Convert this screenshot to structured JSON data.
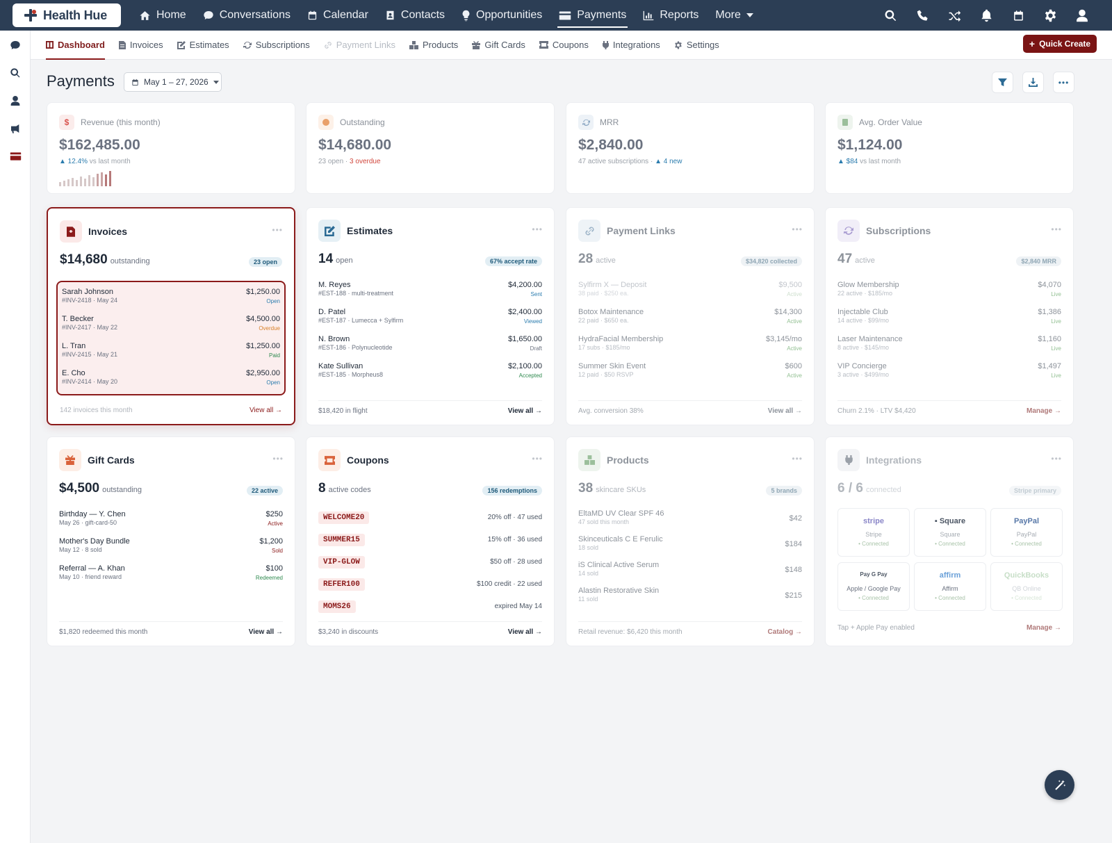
{
  "app": {
    "name": "Health Hue"
  },
  "topnav": {
    "items": [
      {
        "label": "Home",
        "icon": "home-icon"
      },
      {
        "label": "Conversations",
        "icon": "chat-icon"
      },
      {
        "label": "Calendar",
        "icon": "calendar-icon"
      },
      {
        "label": "Contacts",
        "icon": "contacts-icon"
      },
      {
        "label": "Opportunities",
        "icon": "lightbulb-icon"
      },
      {
        "label": "Payments",
        "icon": "card-icon",
        "active": true
      },
      {
        "label": "Reports",
        "icon": "chart-icon"
      },
      {
        "label": "More",
        "icon": "caret-down-icon"
      }
    ],
    "right_icons": [
      "search-icon",
      "phone-icon",
      "shuffle-icon",
      "bell-icon",
      "calendar-icon",
      "gear-icon",
      "user-icon"
    ]
  },
  "leftbar": {
    "icons": [
      "chat-icon",
      "search-icon",
      "user-icon",
      "megaphone-icon",
      "card-icon"
    ]
  },
  "subnav": {
    "items": [
      {
        "label": "Dashboard",
        "active": true
      },
      {
        "label": "Invoices"
      },
      {
        "label": "Estimates"
      },
      {
        "label": "Subscriptions"
      },
      {
        "label": "Payment Links",
        "dim": true
      },
      {
        "label": "Products"
      },
      {
        "label": "Gift Cards"
      },
      {
        "label": "Coupons"
      },
      {
        "label": "Integrations"
      },
      {
        "label": "Settings"
      }
    ],
    "quick_create": "Quick Create"
  },
  "header": {
    "title": "Payments",
    "date_range": "May 1 – 27, 2026",
    "tools": [
      "filter-icon",
      "download-icon",
      "more-icon"
    ]
  },
  "kpis": [
    {
      "label": "Revenue (this month)",
      "value": "$162,485.00",
      "delta": "▲ 12.4%",
      "sub": " vs last month",
      "icon": "dollar-icon",
      "color": "#d9534f",
      "spark": [
        6,
        8,
        10,
        12,
        9,
        14,
        11,
        16,
        13,
        18,
        20,
        17,
        22
      ]
    },
    {
      "label": "Outstanding",
      "value": "$14,680.00",
      "sub": "23 open · ",
      "alert": "3 overdue",
      "icon": "alert-icon",
      "color": "#e08a4a"
    },
    {
      "label": "MRR",
      "value": "$2,840.00",
      "sub": "47 active subscriptions · ",
      "delta": "▲ 4 new",
      "icon": "refresh-icon",
      "color": "#6b8fb5"
    },
    {
      "label": "Avg. Order Value",
      "value": "$1,124.00",
      "delta": "▲ $84",
      "sub": " vs last month",
      "icon": "receipt-icon",
      "color": "#6b9a6b"
    }
  ],
  "invoices": {
    "title": "Invoices",
    "big": "$14,680",
    "big_sub": "outstanding",
    "badge": "23 open",
    "rows": [
      {
        "name": "Sarah Johnson",
        "sub": "#INV-2418 · May 24",
        "amount": "$1,250.00",
        "status": "Open"
      },
      {
        "name": "T. Becker",
        "sub": "#INV-2417 · May 22",
        "amount": "$4,500.00",
        "status": "Overdue"
      },
      {
        "name": "L. Tran",
        "sub": "#INV-2415 · May 21",
        "amount": "$1,250.00",
        "status": "Paid"
      },
      {
        "name": "E. Cho",
        "sub": "#INV-2414 · May 20",
        "amount": "$2,950.00",
        "status": "Open"
      }
    ],
    "foot": "142 invoices this month",
    "link": "View all →"
  },
  "estimates": {
    "title": "Estimates",
    "big": "14",
    "big_sub": "open",
    "badge": "67% accept rate",
    "rows": [
      {
        "name": "M. Reyes",
        "sub": "#EST-188 · multi-treatment",
        "amount": "$4,200.00",
        "status": "Sent"
      },
      {
        "name": "D. Patel",
        "sub": "#EST-187 · Lumecca + Sylfirm",
        "amount": "$2,400.00",
        "status": "Viewed"
      },
      {
        "name": "N. Brown",
        "sub": "#EST-186 · Polynucleotide",
        "amount": "$1,650.00",
        "status": "Draft"
      },
      {
        "name": "Kate Sullivan",
        "sub": "#EST-185 · Morpheus8",
        "amount": "$2,100.00",
        "status": "Accepted"
      }
    ],
    "foot": "$18,420 in flight",
    "link": "View all →"
  },
  "payment_links": {
    "title": "Payment Links",
    "big": "28",
    "big_sub": "active",
    "badge": "$34,820 collected",
    "rows": [
      {
        "name": "Sylfirm X — Deposit",
        "sub": "38 paid · $250 ea.",
        "amount": "$9,500",
        "status": "Active"
      },
      {
        "name": "Botox Maintenance",
        "sub": "22 paid · $650 ea.",
        "amount": "$14,300",
        "status": "Active"
      },
      {
        "name": "HydraFacial Membership",
        "sub": "17 subs · $185/mo",
        "amount": "$3,145/mo",
        "status": "Active"
      },
      {
        "name": "Summer Skin Event",
        "sub": "12 paid · $50 RSVP",
        "amount": "$600",
        "status": "Active"
      }
    ],
    "foot": "Avg. conversion 38%",
    "link": "View all →"
  },
  "subscriptions": {
    "title": "Subscriptions",
    "big": "47",
    "big_sub": "active",
    "badge": "$2,840 MRR",
    "rows": [
      {
        "name": "Glow Membership",
        "sub": "22 active · $185/mo",
        "amount": "$4,070",
        "status": "Live"
      },
      {
        "name": "Injectable Club",
        "sub": "14 active · $99/mo",
        "amount": "$1,386",
        "status": "Live"
      },
      {
        "name": "Laser Maintenance",
        "sub": "8 active · $145/mo",
        "amount": "$1,160",
        "status": "Live"
      },
      {
        "name": "VIP Concierge",
        "sub": "3 active · $499/mo",
        "amount": "$1,497",
        "status": "Live"
      }
    ],
    "foot": "Churn 2.1% · LTV $4,420",
    "link": "Manage →"
  },
  "gift_cards": {
    "title": "Gift Cards",
    "big": "$4,500",
    "big_sub": "outstanding",
    "badge": "22 active",
    "rows": [
      {
        "name": "Birthday — Y. Chen",
        "sub": "May 26 · gift-card-50",
        "amount": "$250",
        "status": "Active"
      },
      {
        "name": "Mother's Day Bundle",
        "sub": "May 12 · 8 sold",
        "amount": "$1,200",
        "status": "Sold"
      },
      {
        "name": "Referral — A. Khan",
        "sub": "May 10 · friend reward",
        "amount": "$100",
        "status": "Redeemed"
      }
    ],
    "foot": "$1,820 redeemed this month",
    "link": "View all →"
  },
  "coupons": {
    "title": "Coupons",
    "big": "8",
    "big_sub": "active codes",
    "badge": "156 redemptions",
    "rows": [
      {
        "code": "WELCOME20",
        "desc": "20% off · 47 used"
      },
      {
        "code": "SUMMER15",
        "desc": "15% off · 36 used"
      },
      {
        "code": "VIP-GLOW",
        "desc": "$50 off · 28 used"
      },
      {
        "code": "REFER100",
        "desc": "$100 credit · 22 used"
      },
      {
        "code": "MOMS26",
        "desc": "expired May 14"
      }
    ],
    "foot": "$3,240 in discounts",
    "link": "View all →"
  },
  "products": {
    "title": "Products",
    "big": "38",
    "big_sub": "skincare SKUs",
    "badge": "5 brands",
    "rows": [
      {
        "name": "EltaMD UV Clear SPF 46",
        "sub": "47 sold this month",
        "amount": "$42"
      },
      {
        "name": "Skinceuticals C E Ferulic",
        "sub": "18 sold",
        "amount": "$184"
      },
      {
        "name": "iS Clinical Active Serum",
        "sub": "14 sold",
        "amount": "$148"
      },
      {
        "name": "Alastin Restorative Skin",
        "sub": "11 sold",
        "amount": "$215"
      }
    ],
    "foot": "Retail revenue: $6,420 this month",
    "link": "Catalog →"
  },
  "integrations": {
    "title": "Integrations",
    "big": "6 / 6",
    "big_sub": "connected",
    "badge": "Stripe primary",
    "items": [
      {
        "logo": "stripe",
        "name": "Stripe",
        "status": "• Connected",
        "color": "#8a86c8"
      },
      {
        "logo": "▪ Square",
        "name": "Square",
        "status": "• Connected",
        "color": "#4b5563"
      },
      {
        "logo": "PayPal",
        "name": "PayPal",
        "status": "• Connected",
        "color": "#5878a8"
      },
      {
        "logo": " Pay  G Pay",
        "name": "Apple / Google Pay",
        "status": "• Connected",
        "color": "#4b5563"
      },
      {
        "logo": "affirm",
        "name": "Affirm",
        "status": "• Connected",
        "color": "#6aa0d8"
      },
      {
        "logo": "QuickBooks",
        "name": "QB Online",
        "status": "• Connected",
        "color": "#b5d5b5"
      }
    ],
    "foot": "Tap + Apple Pay enabled",
    "link": "Manage →"
  },
  "colors": {
    "brand": "#2c3e55",
    "accent": "#8b1a1a",
    "overdue": "#d9822b",
    "paid": "#2f8a4f"
  }
}
